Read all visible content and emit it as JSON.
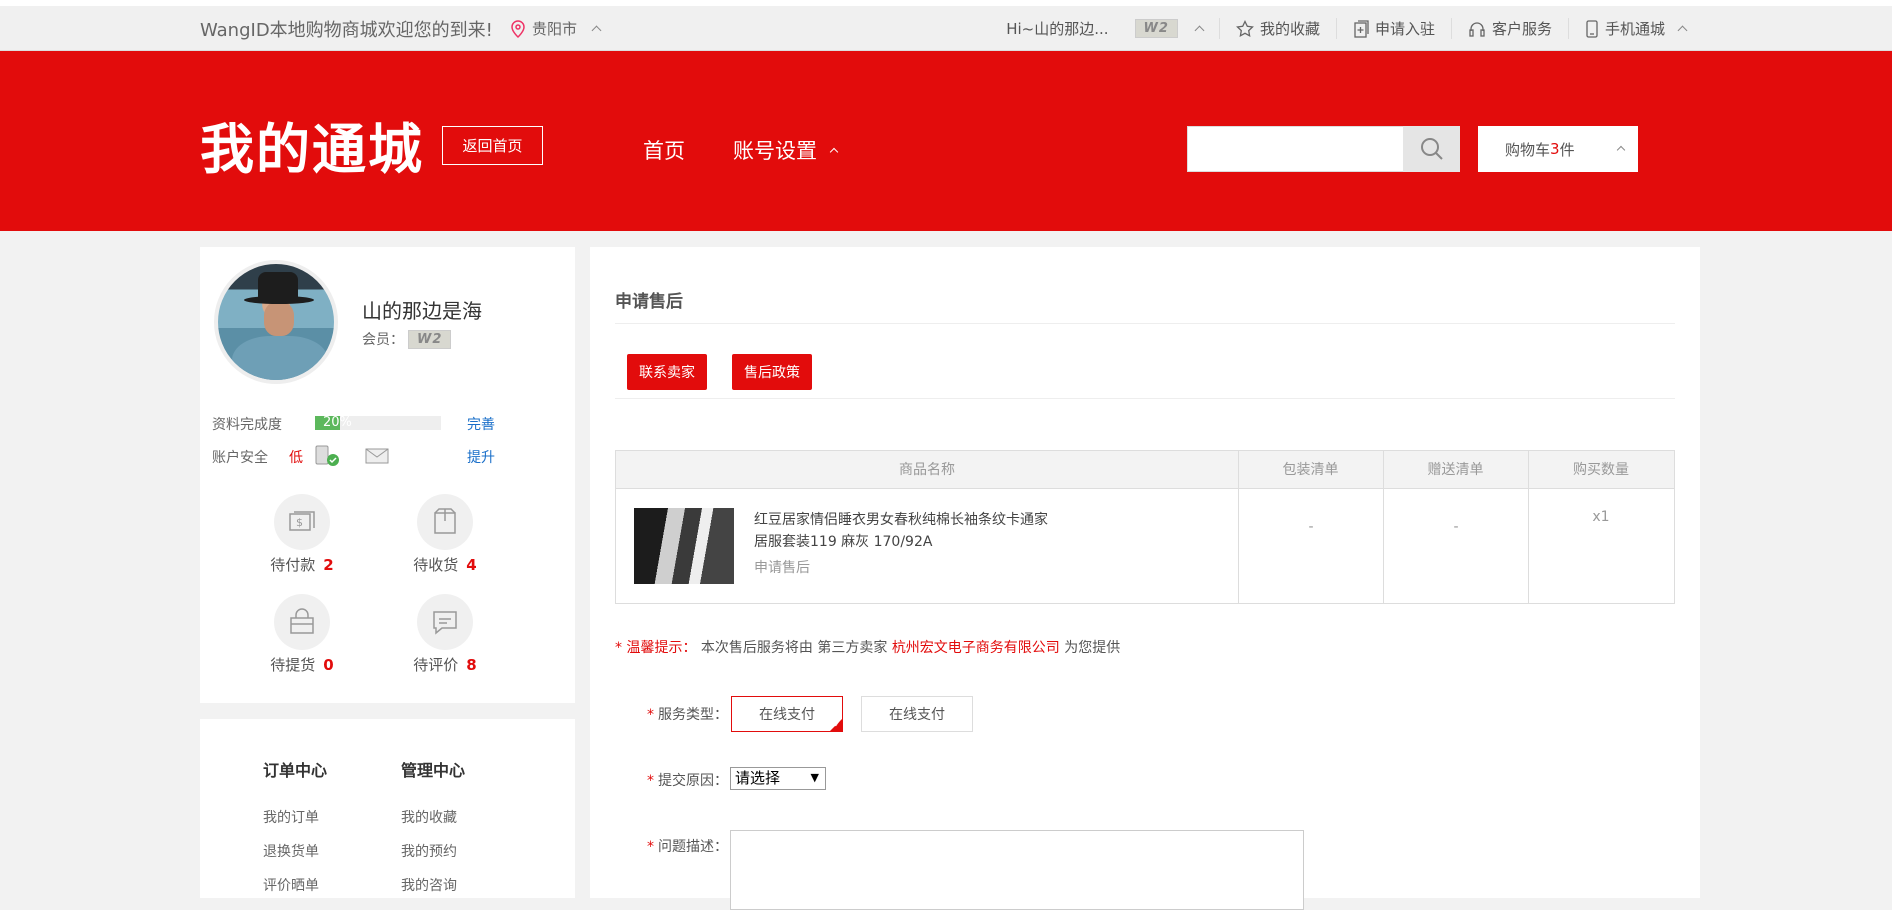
{
  "topbar": {
    "welcome": "WangID本地购物商城欢迎您的到来!",
    "city": "贵阳市",
    "user_greeting": "Hi~山的那边...",
    "member_badge": "W2",
    "favorites": "我的收藏",
    "apply": "申请入驻",
    "service": "客户服务",
    "mobile": "手机通城"
  },
  "header": {
    "logo": "我的通城",
    "back_home": "返回首页",
    "nav_home": "首页",
    "nav_account": "账号设置",
    "search_value": "",
    "cart_prefix": "购物车",
    "cart_count": "3",
    "cart_suffix": "件"
  },
  "profile": {
    "name": "山的那边是海",
    "member_label": "会员：",
    "member_badge": "W2",
    "completion_label": "资料完成度",
    "completion_value": "20%",
    "completion_fraction": 0.2,
    "complete_link": "完善",
    "security_label": "账户安全",
    "security_level": "低",
    "upgrade_link": "提升",
    "stats": [
      {
        "label": "待付款",
        "count": "2"
      },
      {
        "label": "待收货",
        "count": "4"
      },
      {
        "label": "待提货",
        "count": "0"
      },
      {
        "label": "待评价",
        "count": "8"
      }
    ]
  },
  "menu": {
    "order_center": "订单中心",
    "manage_center": "管理中心",
    "order_items": [
      "我的订单",
      "退换货单",
      "评价晒单"
    ],
    "manage_items": [
      "我的收藏",
      "我的预约",
      "我的咨询"
    ]
  },
  "main": {
    "title": "申请售后",
    "contact_seller": "联系卖家",
    "policy": "售后政策",
    "table_headers": [
      "商品名称",
      "包装清单",
      "赠送清单",
      "购买数量"
    ],
    "product": {
      "name": "红豆居家情侣睡衣男女春秋纯棉长袖条纹卡通家居服套装119 麻灰 170/92A",
      "action": "申请售后",
      "package": "-",
      "gift": "-",
      "qty": "x1"
    },
    "tip_label": "温馨提示：",
    "tip_text1": "本次售后服务将由 第三方卖家",
    "tip_company": "杭州宏文电子商务有限公司",
    "tip_text2": "为您提供",
    "service_type_label": "服务类型：",
    "service_options": [
      "在线支付",
      "在线支付"
    ],
    "reason_label": "提交原因：",
    "reason_value": "请选择",
    "desc_label": "问题描述："
  },
  "colors": {
    "brand_red": "#e20c0c",
    "progress_green": "#5cb85c",
    "link_blue": "#1a6fc9"
  }
}
